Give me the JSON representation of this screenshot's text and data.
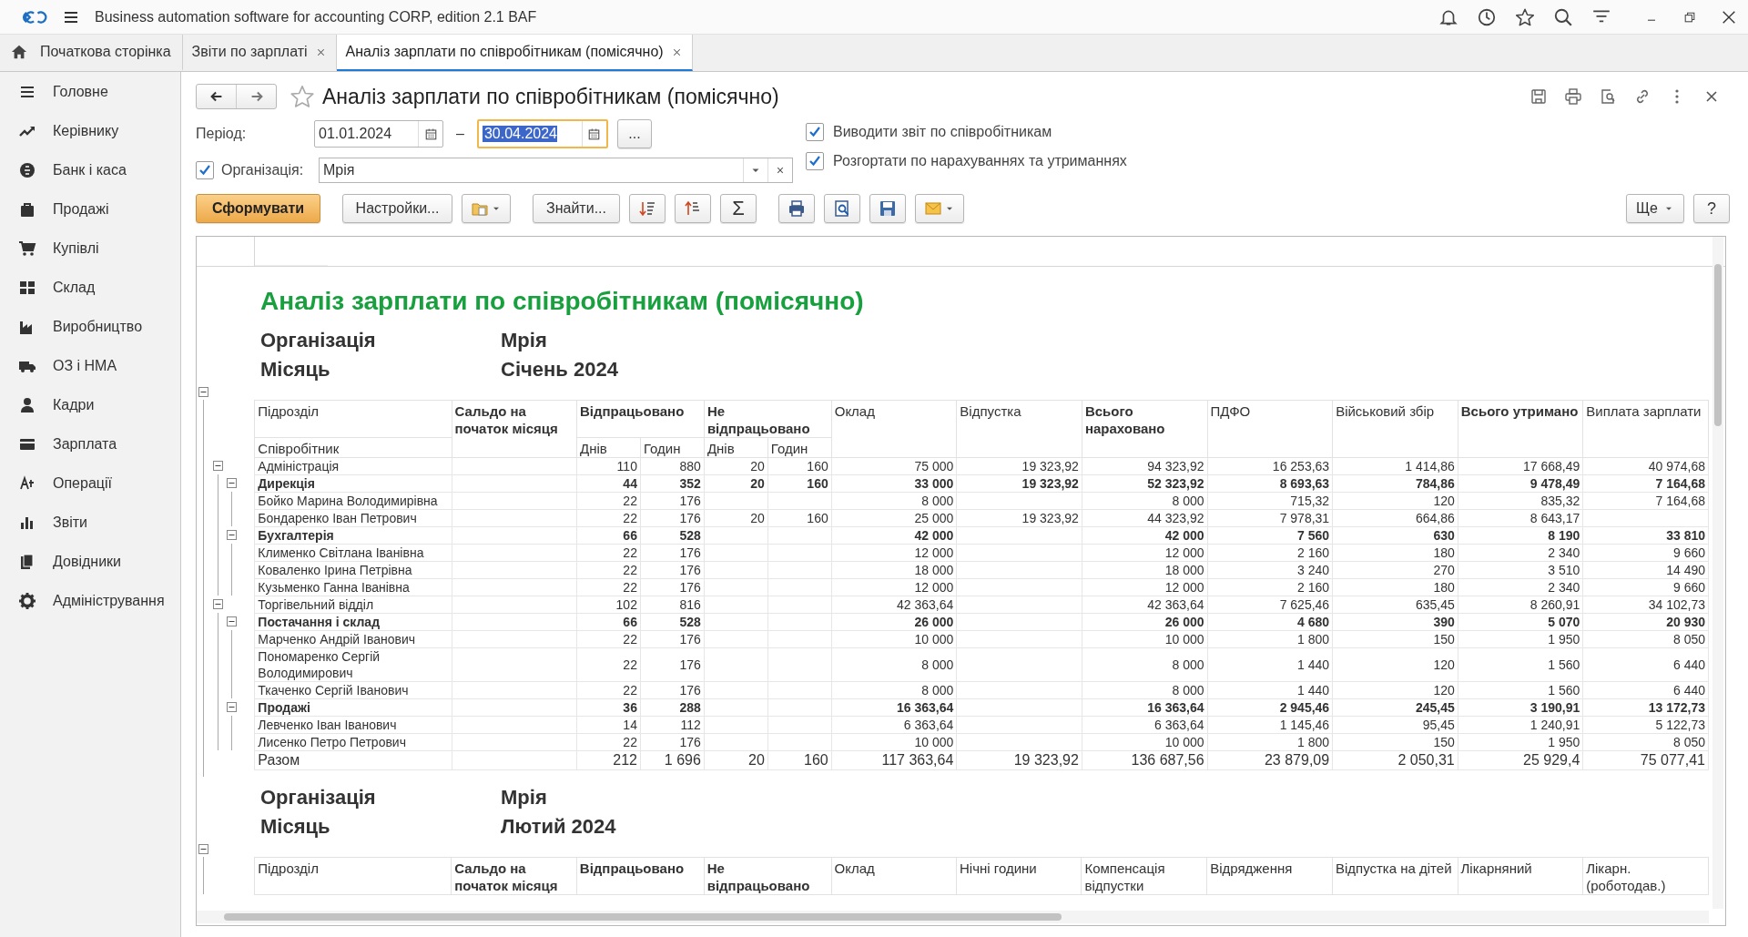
{
  "window": {
    "title": "Business automation software for accounting CORP, edition 2.1 BAF"
  },
  "tabs": [
    {
      "kind": "home",
      "label": "Початкова сторінка",
      "selected": false,
      "closable": false
    },
    {
      "kind": "page",
      "label": "Звіти по зарплаті",
      "selected": false,
      "closable": true
    },
    {
      "kind": "page",
      "label": "Аналіз зарплати по співробітникам (помісячно)",
      "selected": true,
      "closable": true
    }
  ],
  "sidebar": {
    "items": [
      {
        "label": "Головне"
      },
      {
        "label": "Керівнику"
      },
      {
        "label": "Банк і каса"
      },
      {
        "label": "Продажі"
      },
      {
        "label": "Купівлі"
      },
      {
        "label": "Склад"
      },
      {
        "label": "Виробництво"
      },
      {
        "label": "ОЗ і НМА"
      },
      {
        "label": "Кадри"
      },
      {
        "label": "Зарплата"
      },
      {
        "label": "Операції"
      },
      {
        "label": "Звіти"
      },
      {
        "label": "Довідники"
      },
      {
        "label": "Адміністрування"
      }
    ]
  },
  "form": {
    "title": "Аналіз зарплати по співробітникам (помісячно)",
    "favorite": false,
    "period": {
      "label": "Період:",
      "from": "01.01.2024",
      "to": "30.04.2024",
      "separator": "–",
      "more_button": "..."
    },
    "organization": {
      "label": "Організація:",
      "checked": true,
      "value": "Мрія"
    },
    "options": [
      {
        "label": "Виводити звіт по співробітникам",
        "checked": true
      },
      {
        "label": "Розгортати по нарахуваннях та утриманнях",
        "checked": true
      }
    ],
    "toolbar": [
      {
        "kind": "primary",
        "label": "Сформувати"
      },
      {
        "kind": "text",
        "label": "Настройки..."
      },
      {
        "kind": "icon",
        "dropdown": true
      },
      {
        "kind": "text",
        "label": "Знайти..."
      },
      {
        "kind": "icon",
        "dropdown": false
      },
      {
        "kind": "icon",
        "dropdown": false
      },
      {
        "kind": "glyph",
        "label": "Σ"
      },
      {
        "kind": "icon",
        "dropdown": false
      },
      {
        "kind": "icon",
        "dropdown": false
      },
      {
        "kind": "icon",
        "dropdown": false
      },
      {
        "kind": "icon",
        "dropdown": true
      }
    ],
    "toolbar_right": [
      {
        "label": "Ще",
        "dropdown": true
      },
      {
        "label": "?",
        "dropdown": false
      }
    ]
  },
  "report": {
    "title": "Аналіз зарплати по співробітникам (помісячно)",
    "sections": [
      {
        "expanded": true,
        "organization_label": "Організація",
        "organization": "Мрія",
        "month_label": "Місяць",
        "month": "Січень 2024",
        "row_header": {
          "group": "Підрозділ",
          "item": "Співробітник"
        },
        "columns": [
          {
            "label": "Сальдо на початок місяця",
            "emphasis": true
          },
          {
            "label": "Відпрацьовано",
            "emphasis": true,
            "subcolumns": [
              {
                "label": "Днів"
              },
              {
                "label": "Годин"
              }
            ]
          },
          {
            "label": "Не відпрацьовано",
            "emphasis": true,
            "subcolumns": [
              {
                "label": "Днів"
              },
              {
                "label": "Годин"
              }
            ]
          },
          {
            "label": "Оклад",
            "emphasis": false
          },
          {
            "label": "Відпустка",
            "emphasis": false
          },
          {
            "label": "Всього нараховано",
            "emphasis": true
          },
          {
            "label": "ПДФО",
            "emphasis": false
          },
          {
            "label": "Військовий збір",
            "emphasis": false
          },
          {
            "label": "Всього утримано",
            "emphasis": true
          },
          {
            "label": "Виплата зарплати",
            "emphasis": false
          }
        ],
        "rows": [
          {
            "kind": "department",
            "label": "Адміністрація",
            "expanded": true,
            "cells": {
              "worked_days": "110",
              "worked_hours": "880",
              "absent_days": "20",
              "absent_hours": "160",
              "salary": "75 000",
              "vacation": "19 323,92",
              "accrued": "94 323,92",
              "pdfo": "16 253,63",
              "military": "1 414,86",
              "withheld": "17 668,49",
              "payout": "40 974,68"
            },
            "children": [
              {
                "kind": "division",
                "label": "Дирекція",
                "expanded": true,
                "cells": {
                  "worked_days": "44",
                  "worked_hours": "352",
                  "absent_days": "20",
                  "absent_hours": "160",
                  "salary": "33 000",
                  "vacation": "19 323,92",
                  "accrued": "52 323,92",
                  "pdfo": "8 693,63",
                  "military": "784,86",
                  "withheld": "9 478,49",
                  "payout": "7 164,68"
                },
                "children": [
                  {
                    "kind": "employee",
                    "label": "Бойко Марина Володимирівна",
                    "cells": {
                      "worked_days": "22",
                      "worked_hours": "176",
                      "salary": "8 000",
                      "accrued": "8 000",
                      "pdfo": "715,32",
                      "military": "120",
                      "withheld": "835,32",
                      "payout": "7 164,68"
                    }
                  },
                  {
                    "kind": "employee",
                    "label": "Бондаренко Іван Петрович",
                    "cells": {
                      "worked_days": "22",
                      "worked_hours": "176",
                      "absent_days": "20",
                      "absent_hours": "160",
                      "salary": "25 000",
                      "vacation": "19 323,92",
                      "accrued": "44 323,92",
                      "pdfo": "7 978,31",
                      "military": "664,86",
                      "withheld": "8 643,17"
                    }
                  }
                ]
              },
              {
                "kind": "division",
                "label": "Бухгалтерія",
                "expanded": true,
                "cells": {
                  "worked_days": "66",
                  "worked_hours": "528",
                  "salary": "42 000",
                  "accrued": "42 000",
                  "pdfo": "7 560",
                  "military": "630",
                  "withheld": "8 190",
                  "payout": "33 810"
                },
                "children": [
                  {
                    "kind": "employee",
                    "label": "Клименко Світлана Іванівна",
                    "cells": {
                      "worked_days": "22",
                      "worked_hours": "176",
                      "salary": "12 000",
                      "accrued": "12 000",
                      "pdfo": "2 160",
                      "military": "180",
                      "withheld": "2 340",
                      "payout": "9 660"
                    }
                  },
                  {
                    "kind": "employee",
                    "label": "Коваленко Ірина Петрівна",
                    "cells": {
                      "worked_days": "22",
                      "worked_hours": "176",
                      "salary": "18 000",
                      "accrued": "18 000",
                      "pdfo": "3 240",
                      "military": "270",
                      "withheld": "3 510",
                      "payout": "14 490"
                    }
                  },
                  {
                    "kind": "employee",
                    "label": "Кузьменко Ганна Іванівна",
                    "cells": {
                      "worked_days": "22",
                      "worked_hours": "176",
                      "salary": "12 000",
                      "accrued": "12 000",
                      "pdfo": "2 160",
                      "military": "180",
                      "withheld": "2 340",
                      "payout": "9 660"
                    }
                  }
                ]
              }
            ]
          },
          {
            "kind": "department",
            "label": "Торгівельний відділ",
            "expanded": true,
            "cells": {
              "worked_days": "102",
              "worked_hours": "816",
              "salary": "42 363,64",
              "accrued": "42 363,64",
              "pdfo": "7 625,46",
              "military": "635,45",
              "withheld": "8 260,91",
              "payout": "34 102,73"
            },
            "children": [
              {
                "kind": "division",
                "label": "Постачання і склад",
                "expanded": true,
                "cells": {
                  "worked_days": "66",
                  "worked_hours": "528",
                  "salary": "26 000",
                  "accrued": "26 000",
                  "pdfo": "4 680",
                  "military": "390",
                  "withheld": "5 070",
                  "payout": "20 930"
                },
                "children": [
                  {
                    "kind": "employee",
                    "label": "Марченко Андрій Іванович",
                    "cells": {
                      "worked_days": "22",
                      "worked_hours": "176",
                      "salary": "10 000",
                      "accrued": "10 000",
                      "pdfo": "1 800",
                      "military": "150",
                      "withheld": "1 950",
                      "payout": "8 050"
                    }
                  },
                  {
                    "kind": "employee",
                    "label": "Пономаренко Сергій Володимирович",
                    "cells": {
                      "worked_days": "22",
                      "worked_hours": "176",
                      "salary": "8 000",
                      "accrued": "8 000",
                      "pdfo": "1 440",
                      "military": "120",
                      "withheld": "1 560",
                      "payout": "6 440"
                    }
                  },
                  {
                    "kind": "employee",
                    "label": "Ткаченко Сергій Іванович",
                    "cells": {
                      "worked_days": "22",
                      "worked_hours": "176",
                      "salary": "8 000",
                      "accrued": "8 000",
                      "pdfo": "1 440",
                      "military": "120",
                      "withheld": "1 560",
                      "payout": "6 440"
                    }
                  }
                ]
              },
              {
                "kind": "division",
                "label": "Продажі",
                "expanded": true,
                "cells": {
                  "worked_days": "36",
                  "worked_hours": "288",
                  "salary": "16 363,64",
                  "accrued": "16 363,64",
                  "pdfo": "2 945,46",
                  "military": "245,45",
                  "withheld": "3 190,91",
                  "payout": "13 172,73"
                },
                "children": [
                  {
                    "kind": "employee",
                    "label": "Левченко Іван Іванович",
                    "cells": {
                      "worked_days": "14",
                      "worked_hours": "112",
                      "salary": "6 363,64",
                      "accrued": "6 363,64",
                      "pdfo": "1 145,46",
                      "military": "95,45",
                      "withheld": "1 240,91",
                      "payout": "5 122,73"
                    }
                  },
                  {
                    "kind": "employee",
                    "label": "Лисенко Петро Петрович",
                    "cells": {
                      "worked_days": "22",
                      "worked_hours": "176",
                      "salary": "10 000",
                      "accrued": "10 000",
                      "pdfo": "1 800",
                      "military": "150",
                      "withheld": "1 950",
                      "payout": "8 050"
                    }
                  }
                ]
              }
            ]
          },
          {
            "kind": "total",
            "label": "Разом",
            "cells": {
              "worked_days": "212",
              "worked_hours": "1 696",
              "absent_days": "20",
              "absent_hours": "160",
              "salary": "117 363,64",
              "vacation": "19 323,92",
              "accrued": "136 687,56",
              "pdfo": "23 879,09",
              "military": "2 050,31",
              "withheld": "25 929,4",
              "payout": "75 077,41"
            }
          }
        ]
      },
      {
        "expanded": true,
        "organization_label": "Організація",
        "organization": "Мрія",
        "month_label": "Місяць",
        "month": "Лютий 2024",
        "row_header": {
          "group": "Підрозділ"
        },
        "columns": [
          {
            "label": "Сальдо на початок місяця",
            "emphasis": true
          },
          {
            "label": "Відпрацьовано",
            "emphasis": true,
            "kind": "group"
          },
          {
            "label": "Не відпрацьовано",
            "emphasis": true,
            "kind": "group"
          },
          {
            "label": "Оклад",
            "emphasis": false
          },
          {
            "label": "Нічні години",
            "emphasis": false
          },
          {
            "label": "Компенсація відпустки",
            "emphasis": false
          },
          {
            "label": "Відрядження",
            "emphasis": false
          },
          {
            "label": "Відпустка на дітей",
            "emphasis": false
          },
          {
            "label": "Лікарняний",
            "emphasis": false
          },
          {
            "label": "Лікарн. (роботодав.)",
            "emphasis": false
          }
        ]
      }
    ]
  }
}
